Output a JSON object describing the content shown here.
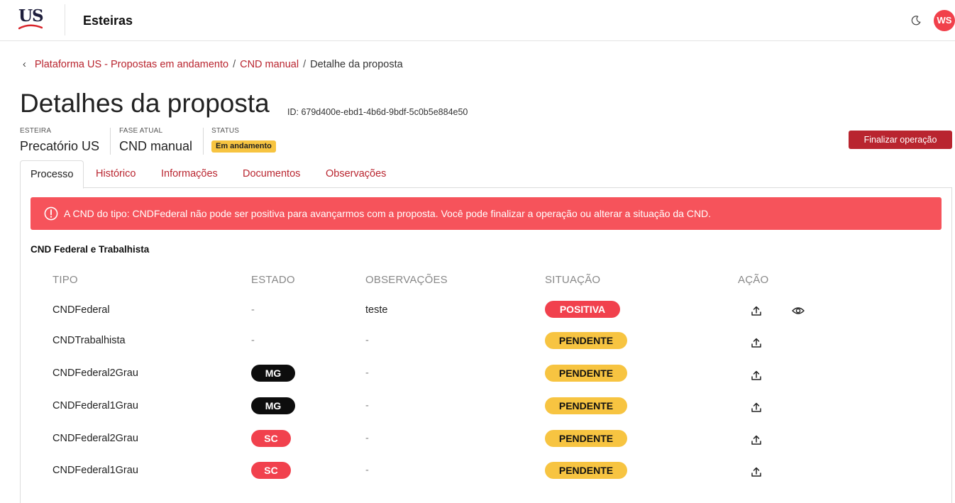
{
  "header": {
    "logo_text": "US",
    "app_title": "Esteiras",
    "avatar_initials": "WS"
  },
  "breadcrumb": {
    "items": [
      "Plataforma US - Propostas em andamento",
      "CND manual",
      "Detalhe da proposta"
    ],
    "separator": "/"
  },
  "page": {
    "title": "Detalhes da proposta",
    "id_text": "ID: 679d400e-ebd1-4b6d-9bdf-5c0b5e884e50"
  },
  "meta": {
    "esteira_label": "ESTEIRA",
    "esteira_value": "Precatório US",
    "fase_label": "FASE ATUAL",
    "fase_value": "CND manual",
    "status_label": "STATUS",
    "status_value": "Em andamento"
  },
  "actions": {
    "finalize_label": "Finalizar operação"
  },
  "tabs": [
    "Processo",
    "Histórico",
    "Informações",
    "Documentos",
    "Observações"
  ],
  "alert": {
    "text": "A CND do tipo: CNDFederal não pode ser positiva para avançarmos com a proposta. Você pode finalizar a operação ou alterar a situação da CND."
  },
  "section": {
    "title": "CND Federal e Trabalhista"
  },
  "table": {
    "headers": [
      "TIPO",
      "ESTADO",
      "OBSERVAÇÕES",
      "SITUAÇÃO",
      "AÇÃO"
    ],
    "rows": [
      {
        "tipo": "CNDFederal",
        "estado": "-",
        "observacoes": "teste",
        "situacao": "POSITIVA"
      },
      {
        "tipo": "CNDTrabalhista",
        "estado": "-",
        "observacoes": "-",
        "situacao": "PENDENTE"
      },
      {
        "tipo": "CNDFederal2Grau",
        "estado": "MG",
        "observacoes": "-",
        "situacao": "PENDENTE"
      },
      {
        "tipo": "CNDFederal1Grau",
        "estado": "MG",
        "observacoes": "-",
        "situacao": "PENDENTE"
      },
      {
        "tipo": "CNDFederal2Grau",
        "estado": "SC",
        "observacoes": "-",
        "situacao": "PENDENTE"
      },
      {
        "tipo": "CNDFederal1Grau",
        "estado": "SC",
        "observacoes": "-",
        "situacao": "PENDENTE"
      }
    ],
    "icons": [
      "upload-icon",
      "eye-icon"
    ]
  },
  "colors": {
    "brand_red": "#b9252f",
    "alert_red": "#f6535b",
    "badge_yellow": "#f7c441",
    "avatar_red": "#f1404b",
    "pill_black": "#0d0d0d"
  }
}
